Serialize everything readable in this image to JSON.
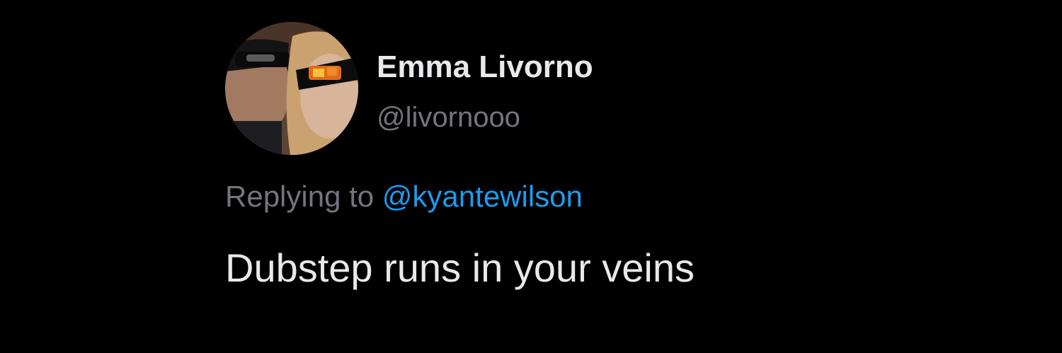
{
  "tweet": {
    "author": {
      "display_name": "Emma Livorno",
      "handle": "@livornooo",
      "avatar_icon": "profile-photo"
    },
    "reply": {
      "prefix": "Replying to",
      "mention": "@kyantewilson"
    },
    "text": "Dubstep runs in your veins"
  },
  "colors": {
    "background": "#000000",
    "primary_text": "#e7e9ea",
    "secondary_text": "#71767b",
    "link": "#1d9bf0"
  }
}
